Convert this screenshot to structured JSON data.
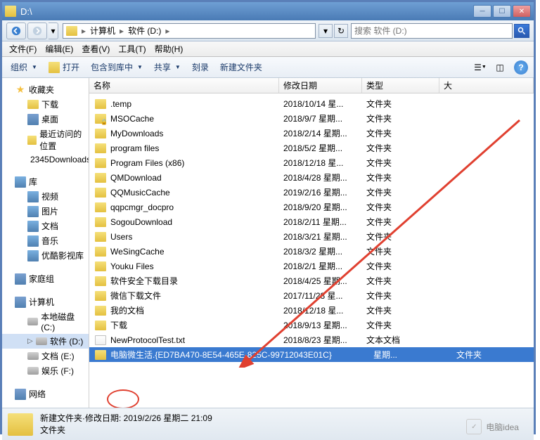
{
  "window": {
    "title": "D:\\"
  },
  "nav": {
    "crumbs": [
      "计算机",
      "软件 (D:)"
    ],
    "search_placeholder": "搜索 软件 (D:)"
  },
  "menu": {
    "file": "文件(F)",
    "edit": "编辑(E)",
    "view": "查看(V)",
    "tools": "工具(T)",
    "help": "帮助(H)"
  },
  "toolbar": {
    "organize": "组织",
    "open": "打开",
    "include": "包含到库中",
    "share": "共享",
    "burn": "刻录",
    "newfolder": "新建文件夹"
  },
  "sidebar": {
    "favorites": "收藏夹",
    "downloads": "下载",
    "desktop": "桌面",
    "recent": "最近访问的位置",
    "dl2345": "2345Downloads",
    "libraries": "库",
    "videos": "视频",
    "pictures": "图片",
    "documents": "文档",
    "music": "音乐",
    "youku": "优酷影视库",
    "homegroup": "家庭组",
    "computer": "计算机",
    "drive_c": "本地磁盘 (C:)",
    "drive_d": "软件 (D:)",
    "drive_e": "文档 (E:)",
    "drive_f": "娱乐 (F:)",
    "network": "网络"
  },
  "columns": {
    "name": "名称",
    "date": "修改日期",
    "type": "类型",
    "size": "大"
  },
  "files": [
    {
      "name": ".temp",
      "date": "2018/10/14 星...",
      "type": "文件夹",
      "icon": "folder"
    },
    {
      "name": "MSOCache",
      "date": "2018/9/7 星期...",
      "type": "文件夹",
      "icon": "locked"
    },
    {
      "name": "MyDownloads",
      "date": "2018/2/14 星期...",
      "type": "文件夹",
      "icon": "folder"
    },
    {
      "name": "program files",
      "date": "2018/5/2 星期...",
      "type": "文件夹",
      "icon": "folder"
    },
    {
      "name": "Program Files (x86)",
      "date": "2018/12/18 星...",
      "type": "文件夹",
      "icon": "folder"
    },
    {
      "name": "QMDownload",
      "date": "2018/4/28 星期...",
      "type": "文件夹",
      "icon": "folder"
    },
    {
      "name": "QQMusicCache",
      "date": "2019/2/16 星期...",
      "type": "文件夹",
      "icon": "folder"
    },
    {
      "name": "qqpcmgr_docpro",
      "date": "2018/9/20 星期...",
      "type": "文件夹",
      "icon": "folder"
    },
    {
      "name": "SogouDownload",
      "date": "2018/2/11 星期...",
      "type": "文件夹",
      "icon": "folder"
    },
    {
      "name": "Users",
      "date": "2018/3/21 星期...",
      "type": "文件夹",
      "icon": "folder"
    },
    {
      "name": "WeSingCache",
      "date": "2018/3/2 星期...",
      "type": "文件夹",
      "icon": "folder"
    },
    {
      "name": "Youku Files",
      "date": "2018/2/1 星期...",
      "type": "文件夹",
      "icon": "folder"
    },
    {
      "name": "软件安全下载目录",
      "date": "2018/4/25 星期...",
      "type": "文件夹",
      "icon": "folder"
    },
    {
      "name": "微信下载文件",
      "date": "2017/11/28 星...",
      "type": "文件夹",
      "icon": "folder"
    },
    {
      "name": "我的文档",
      "date": "2018/12/18 星...",
      "type": "文件夹",
      "icon": "folder"
    },
    {
      "name": "下载",
      "date": "2018/9/13 星期...",
      "type": "文件夹",
      "icon": "folder"
    },
    {
      "name": "NewProtocolTest.txt",
      "date": "2018/8/23 星期...",
      "type": "文本文档",
      "icon": "txt"
    },
    {
      "name": "电脑微生活.{ED7BA470-8E54-465E-825C-99712043E01C}",
      "date": "星期...",
      "type": "文件夹",
      "icon": "folder",
      "selected": true
    }
  ],
  "status": {
    "line1": "新建文件夹·修改日期: 2019/2/26 星期二 21:09",
    "line2": "文件夹"
  },
  "watermark": {
    "text": "电脑idea"
  }
}
